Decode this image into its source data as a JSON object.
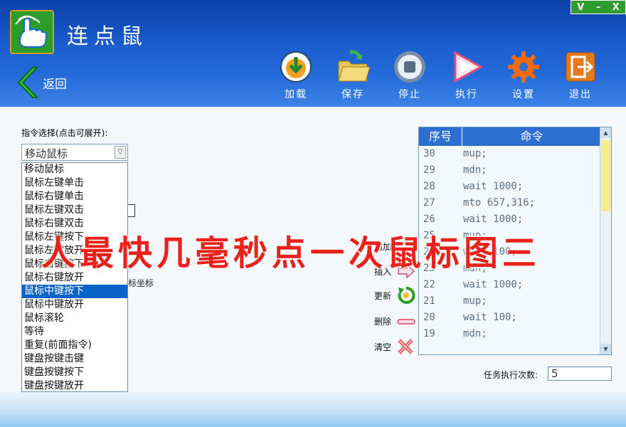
{
  "window": {
    "title": "连点鼠",
    "controls": [
      "V",
      "–",
      "X"
    ]
  },
  "nav": {
    "back_label": "返回"
  },
  "toolbar": [
    {
      "label": "加载",
      "icon": "load-icon"
    },
    {
      "label": "保存",
      "icon": "save-icon"
    },
    {
      "label": "停止",
      "icon": "stop-icon"
    },
    {
      "label": "执行",
      "icon": "play-icon"
    },
    {
      "label": "设置",
      "icon": "gear-icon"
    },
    {
      "label": "退出",
      "icon": "exit-icon"
    }
  ],
  "command_select": {
    "label": "指令选择(点击可展开):",
    "value": "移动鼠标",
    "options": [
      "移动鼠标",
      "鼠标左键单击",
      "鼠标右键单击",
      "鼠标左键双击",
      "鼠标右键双击",
      "鼠标左键按下",
      "鼠标左键放开",
      "鼠标右键按下",
      "鼠标右键放开",
      "鼠标中键按下",
      "鼠标中键放开",
      "鼠标滚轮",
      "等待",
      "重复(前面指令)",
      "键盘按键击键",
      "键盘按键按下",
      "键盘按键放开"
    ],
    "selected_index": 9
  },
  "hidden_label": "标坐标",
  "actions": [
    {
      "label": "追加",
      "icon": "append-arrow-icon"
    },
    {
      "label": "插入",
      "icon": "insert-arrow-icon"
    },
    {
      "label": "更新",
      "icon": "refresh-icon"
    },
    {
      "label": "删除",
      "icon": "minus-icon"
    },
    {
      "label": "清空",
      "icon": "clear-x-icon"
    }
  ],
  "command_list": {
    "headers": [
      "序号",
      "命令"
    ],
    "rows": [
      {
        "n": "30",
        "cmd": "mup;"
      },
      {
        "n": "29",
        "cmd": "mdn;"
      },
      {
        "n": "28",
        "cmd": "wait 1000;"
      },
      {
        "n": "27",
        "cmd": "mto 657,316;"
      },
      {
        "n": "26",
        "cmd": "wait 1000;"
      },
      {
        "n": "25",
        "cmd": "mup;"
      },
      {
        "n": "24",
        "cmd": "wait 100;"
      },
      {
        "n": "23",
        "cmd": "mdn;"
      },
      {
        "n": "22",
        "cmd": "wait 1000;"
      },
      {
        "n": "21",
        "cmd": "mup;"
      },
      {
        "n": "20",
        "cmd": "wait 100;"
      },
      {
        "n": "19",
        "cmd": "mdn;"
      }
    ]
  },
  "task_count": {
    "label": "任务执行次数:",
    "value": "5"
  },
  "overlay_text": "人最快几毫秒点一次鼠标图三",
  "colors": {
    "header_top": "#0a3fa8",
    "header_bottom": "#2b77e3",
    "selected": "#0a63c9",
    "overlay": "#e8221a"
  }
}
